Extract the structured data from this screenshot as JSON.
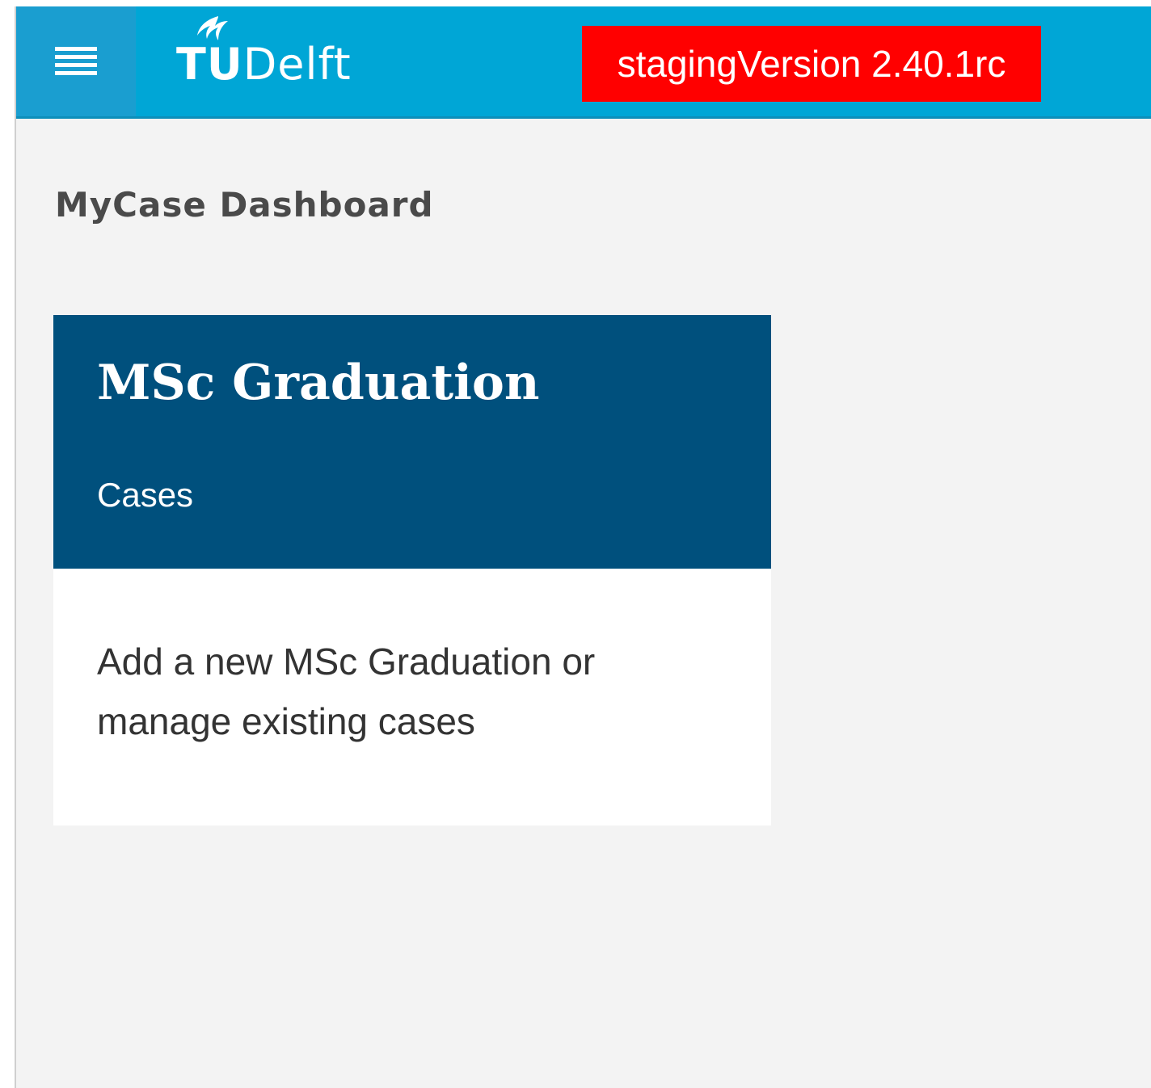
{
  "header": {
    "menu_icon": "hamburger-menu-icon",
    "logo": {
      "tu": "TU",
      "delft": "Delft",
      "flame_icon": "tudelft-flame-icon"
    },
    "environment_badge": "stagingVersion 2.40.1rc",
    "colors": {
      "bar": "#00a6d6",
      "badge": "#ff0000"
    }
  },
  "page": {
    "title": "MyCase Dashboard"
  },
  "cards": [
    {
      "title": "MSc Graduation",
      "subtitle": "Cases",
      "description": "Add a new MSc Graduation or manage existing cases",
      "header_color": "#00507d"
    }
  ]
}
